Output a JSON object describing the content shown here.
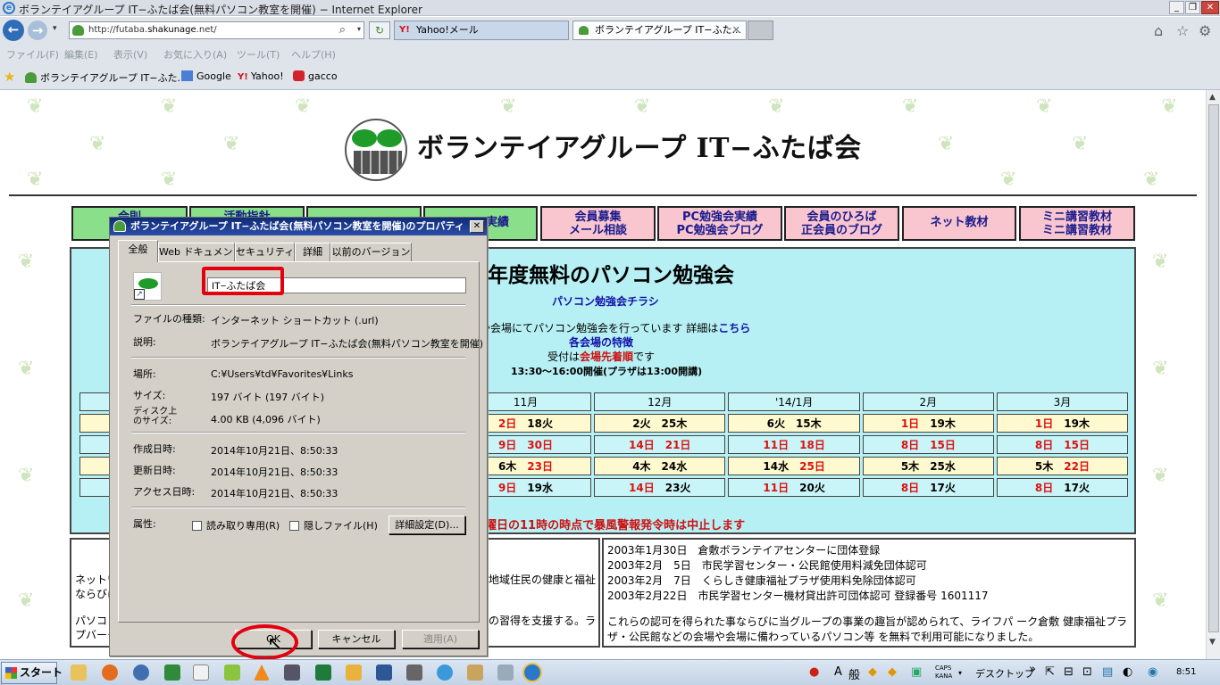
{
  "window": {
    "title": "ボランテイアグループ IT−ふたば会(無料パソコン教室を開催) − Internet Explorer",
    "ie_glyph": "e",
    "min": "_",
    "max": "❐",
    "close": "✕"
  },
  "navbar": {
    "back": "←",
    "forward": "→",
    "address_host_pre": "http://futaba.",
    "address_host_bold": "shakunage",
    "address_host_post": ".net/",
    "search_glyph": "⌕",
    "dropdown_glyph": "▾",
    "refresh_glyph": "↻",
    "tabs": [
      {
        "label": "Yahoo!メール",
        "icon": "Y!"
      },
      {
        "label": "ボランテイアグループ IT−ふた...",
        "close": "✕"
      }
    ],
    "right_icons": [
      "⌂",
      "☆",
      "⚙"
    ]
  },
  "menubar": [
    "ファイル(F)",
    "編集(E)",
    "表示(V)",
    "お気に入り(A)",
    "ツール(T)",
    "ヘルプ(H)"
  ],
  "favorites": [
    {
      "label": "ボランテイアグループ IT−ふた..."
    },
    {
      "label": "Google"
    },
    {
      "label": "Yahoo!",
      "icon": "Y!"
    },
    {
      "label": "gacco"
    }
  ],
  "page": {
    "site_title": "ボランテイアグループ IT−ふたば会",
    "menu": [
      {
        "l1": "会則",
        "l2": ""
      },
      {
        "l1": "活動指針",
        "l2": ""
      },
      {
        "l1": "",
        "l2": ""
      },
      {
        "l1": "実績",
        "l2": ""
      },
      {
        "l1": "会員募集",
        "l2": "メール相談"
      },
      {
        "l1": "PC勉強会実績",
        "l2": "PC勉強会ブログ"
      },
      {
        "l1": "会員のひろば",
        "l2": "正会員のブログ"
      },
      {
        "l1": "ネット教材",
        "l2": ""
      },
      {
        "l1": "ミニ講習教材",
        "l2": "ミニ講習教材"
      }
    ],
    "panel_heading": "年度無料のパソコン勉強会",
    "flyer_link": "パソコン勉強会チラシ",
    "intro_pre": "か会場にてパソコン勉強会を行っています 詳細は",
    "intro_link": "こちら",
    "features": "各会場の特徴",
    "reception_pre": "受付は",
    "reception_red": "会場先着順",
    "reception_post": "です",
    "hours": "13:30〜16:00開催(プラザは13:00開講)",
    "months": [
      "11月",
      "12月",
      "'14/1月",
      "2月",
      "3月"
    ],
    "rows": [
      {
        "cls": "y",
        "cells": [
          [
            "2日",
            "18火"
          ],
          [
            "2火",
            "25木"
          ],
          [
            "6火",
            "15木"
          ],
          [
            "1日",
            "19木"
          ],
          [
            "1日",
            "19木"
          ]
        ]
      },
      {
        "cls": "c",
        "cells": [
          [
            "9日",
            "30日"
          ],
          [
            "14日",
            "21日"
          ],
          [
            "11日",
            "18日"
          ],
          [
            "8日",
            "15日"
          ],
          [
            "8日",
            "15日"
          ]
        ]
      },
      {
        "cls": "y",
        "cells": [
          [
            "6木",
            "23日"
          ],
          [
            "4木",
            "24水"
          ],
          [
            "14水",
            "25日"
          ],
          [
            "5木",
            "25水"
          ],
          [
            "5木",
            "22日"
          ]
        ]
      },
      {
        "cls": "c",
        "cells": [
          [
            "9日",
            "19水"
          ],
          [
            "14日",
            "23火"
          ],
          [
            "11日",
            "20火"
          ],
          [
            "8日",
            "17火"
          ],
          [
            "8日",
            "17火"
          ]
        ]
      }
    ],
    "warning": "曜日の11時の時点で暴風警報発令時は中止します",
    "lower_left": {
      "l1": "ネットワ",
      "l2": "ならびに",
      "l3": "地域住民の健康と福祉",
      "l4": "パソコン",
      "l5": "の習得を支援する。ラ",
      "l6": "プバーク"
    },
    "history": [
      "2003年1月30日　倉敷ボランテイアセンターに団体登録",
      "2003年2月　5日　市民学習センター・公民館使用料減免団体認可",
      "2003年2月　7日　くらしき健康福祉プラザ使用料免除団体認可",
      "2003年2月22日　市民学習センター機材貸出許可団体認可 登録番号 1601117"
    ],
    "history_note1": "これらの認可を得られた事ならびに当グループの事業の趣旨が認められて、ライフパ ーク倉敷 健康福祉プラ",
    "history_note2": "ザ・公民館などの会場や会場に備わっているパソコン等 を無料で利用可能になりました。"
  },
  "dialog": {
    "title": "ボランテイアグループ IT−ふたば会(無料パソコン教室を開催)のプロパティ",
    "close": "✕",
    "tabs": [
      "全般",
      "Web ドキュメント",
      "セキュリティ",
      "詳細",
      "以前のバージョン"
    ],
    "name_value": "IT−ふたば会",
    "props": [
      {
        "label": "ファイルの種類:",
        "value": "インターネット ショートカット (.url)"
      },
      {
        "label": "説明:",
        "value": "ボランテイアグループ IT−ふたば会(無料パソコン教室を開催)"
      },
      {
        "label": "場所:",
        "value": "C:¥Users¥td¥Favorites¥Links"
      },
      {
        "label": "サイズ:",
        "value": "197 バイト (197 バイト)"
      },
      {
        "label": "ディスク上\nのサイズ:",
        "value": "4.00 KB (4,096 バイト)"
      },
      {
        "label": "作成日時:",
        "value": "2014年10月21日、8:50:33"
      },
      {
        "label": "更新日時:",
        "value": "2014年10月21日、8:50:33"
      },
      {
        "label": "アクセス日時:",
        "value": "2014年10月21日、8:50:33"
      }
    ],
    "attr_label": "属性:",
    "readonly_label": "読み取り専用(R)",
    "hidden_label": "隠しファイル(H)",
    "advanced_label": "詳細設定(D)...",
    "ok_label": "OK",
    "cancel_label": "キャンセル",
    "apply_label": "適用(A)"
  },
  "taskbar": {
    "start_label": "スタート",
    "ime_a": "A",
    "ime_mode": "般",
    "caps": "CAPS",
    "kana": "KANA",
    "desktop_label": "デスクトップ",
    "chevron": "»",
    "clock": "8:51"
  }
}
